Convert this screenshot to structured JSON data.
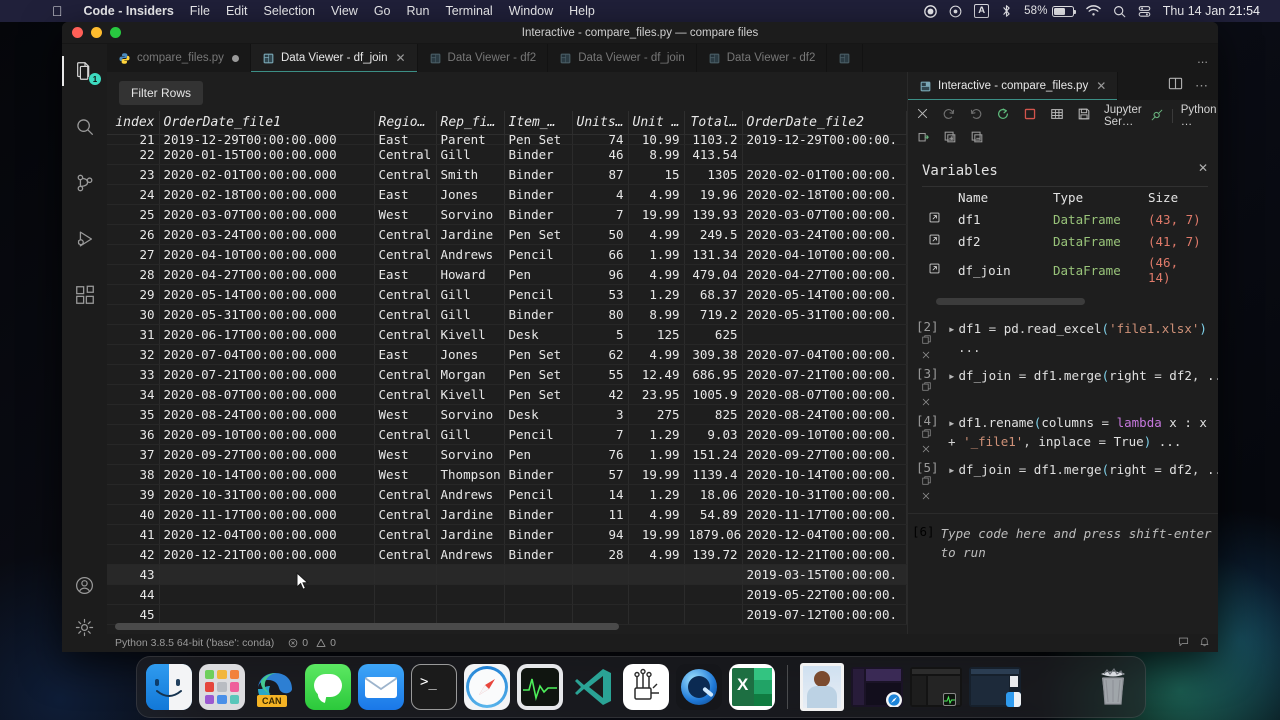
{
  "menubar": {
    "apple_icon": "apple-logo-icon",
    "app_name": "Code - Insiders",
    "items": [
      "File",
      "Edit",
      "Selection",
      "View",
      "Go",
      "Run",
      "Terminal",
      "Window",
      "Help"
    ],
    "status": {
      "record_icon": "record-icon",
      "screen_record_icon": "screen-record-icon",
      "input_source": "A",
      "bluetooth_icon": "bluetooth-icon",
      "battery_percent": "58%",
      "wifi_icon": "wifi-icon",
      "search_icon": "spotlight-search-icon",
      "control_center_icon": "control-center-icon",
      "clock": "Thu 14 Jan  21:54"
    }
  },
  "window": {
    "title": "Interactive - compare_files.py — compare files"
  },
  "activitybar": {
    "items": [
      {
        "name": "explorer",
        "icon": "files-icon",
        "badge": "1",
        "active": true
      },
      {
        "name": "search",
        "icon": "search-icon",
        "badge": "",
        "active": false
      },
      {
        "name": "source-control",
        "icon": "source-control-icon",
        "badge": "",
        "active": false
      },
      {
        "name": "run-and-debug",
        "icon": "run-debug-icon",
        "badge": "",
        "active": false
      },
      {
        "name": "extensions",
        "icon": "extensions-icon",
        "badge": "",
        "active": false
      }
    ],
    "bottom": [
      {
        "name": "accounts",
        "icon": "account-icon"
      },
      {
        "name": "manage",
        "icon": "gear-icon"
      }
    ]
  },
  "tabs": {
    "left_group": [
      {
        "label": "compare_files.py",
        "icon": "python-file-icon",
        "active": false,
        "dirty": true
      },
      {
        "label": "Data Viewer - df_join",
        "icon": "data-viewer-icon",
        "active": true,
        "dirty": false
      },
      {
        "label": "Data Viewer - df2",
        "icon": "data-viewer-icon",
        "active": false,
        "dirty": false
      },
      {
        "label": "Data Viewer - df_join",
        "icon": "data-viewer-icon",
        "active": false,
        "dirty": false
      },
      {
        "label": "Data Viewer - df2",
        "icon": "data-viewer-icon",
        "active": false,
        "dirty": false
      }
    ],
    "left_overflow": "...",
    "right_group": [
      {
        "label": "Interactive - compare_files.py",
        "icon": "notebook-icon",
        "active": true,
        "dirty": false
      }
    ],
    "right_actions": [
      "split-editor-icon",
      "more-actions-icon"
    ]
  },
  "dataviewer": {
    "filter_button": "Filter Rows",
    "columns": [
      "index",
      "OrderDate_file1",
      "Regio…",
      "Rep_fi…",
      "Item_…",
      "Units…",
      "Unit …",
      "Total…",
      "OrderDate_file2"
    ],
    "clipped_top_row": [
      "21",
      "2019-12-29T00:00:00.000",
      "East",
      "Parent",
      "Pen Set",
      "74",
      "10.99",
      "1103.2",
      "2019-12-29T00:00:00."
    ],
    "rows": [
      [
        "22",
        "2020-01-15T00:00:00.000",
        "Central",
        "Gill",
        "Binder",
        "46",
        "8.99",
        "413.54",
        ""
      ],
      [
        "23",
        "2020-02-01T00:00:00.000",
        "Central",
        "Smith",
        "Binder",
        "87",
        "15",
        "1305",
        "2020-02-01T00:00:00."
      ],
      [
        "24",
        "2020-02-18T00:00:00.000",
        "East",
        "Jones",
        "Binder",
        "4",
        "4.99",
        "19.96",
        "2020-02-18T00:00:00."
      ],
      [
        "25",
        "2020-03-07T00:00:00.000",
        "West",
        "Sorvino",
        "Binder",
        "7",
        "19.99",
        "139.93",
        "2020-03-07T00:00:00."
      ],
      [
        "26",
        "2020-03-24T00:00:00.000",
        "Central",
        "Jardine",
        "Pen Set",
        "50",
        "4.99",
        "249.5",
        "2020-03-24T00:00:00."
      ],
      [
        "27",
        "2020-04-10T00:00:00.000",
        "Central",
        "Andrews",
        "Pencil",
        "66",
        "1.99",
        "131.34",
        "2020-04-10T00:00:00."
      ],
      [
        "28",
        "2020-04-27T00:00:00.000",
        "East",
        "Howard",
        "Pen",
        "96",
        "4.99",
        "479.04",
        "2020-04-27T00:00:00."
      ],
      [
        "29",
        "2020-05-14T00:00:00.000",
        "Central",
        "Gill",
        "Pencil",
        "53",
        "1.29",
        "68.37",
        "2020-05-14T00:00:00."
      ],
      [
        "30",
        "2020-05-31T00:00:00.000",
        "Central",
        "Gill",
        "Binder",
        "80",
        "8.99",
        "719.2",
        "2020-05-31T00:00:00."
      ],
      [
        "31",
        "2020-06-17T00:00:00.000",
        "Central",
        "Kivell",
        "Desk",
        "5",
        "125",
        "625",
        ""
      ],
      [
        "32",
        "2020-07-04T00:00:00.000",
        "East",
        "Jones",
        "Pen Set",
        "62",
        "4.99",
        "309.38",
        "2020-07-04T00:00:00."
      ],
      [
        "33",
        "2020-07-21T00:00:00.000",
        "Central",
        "Morgan",
        "Pen Set",
        "55",
        "12.49",
        "686.95",
        "2020-07-21T00:00:00."
      ],
      [
        "34",
        "2020-08-07T00:00:00.000",
        "Central",
        "Kivell",
        "Pen Set",
        "42",
        "23.95",
        "1005.9",
        "2020-08-07T00:00:00."
      ],
      [
        "35",
        "2020-08-24T00:00:00.000",
        "West",
        "Sorvino",
        "Desk",
        "3",
        "275",
        "825",
        "2020-08-24T00:00:00."
      ],
      [
        "36",
        "2020-09-10T00:00:00.000",
        "Central",
        "Gill",
        "Pencil",
        "7",
        "1.29",
        "9.03",
        "2020-09-10T00:00:00."
      ],
      [
        "37",
        "2020-09-27T00:00:00.000",
        "West",
        "Sorvino",
        "Pen",
        "76",
        "1.99",
        "151.24",
        "2020-09-27T00:00:00."
      ],
      [
        "38",
        "2020-10-14T00:00:00.000",
        "West",
        "Thompson",
        "Binder",
        "57",
        "19.99",
        "1139.4",
        "2020-10-14T00:00:00."
      ],
      [
        "39",
        "2020-10-31T00:00:00.000",
        "Central",
        "Andrews",
        "Pencil",
        "14",
        "1.29",
        "18.06",
        "2020-10-31T00:00:00."
      ],
      [
        "40",
        "2020-11-17T00:00:00.000",
        "Central",
        "Jardine",
        "Binder",
        "11",
        "4.99",
        "54.89",
        "2020-11-17T00:00:00."
      ],
      [
        "41",
        "2020-12-04T00:00:00.000",
        "Central",
        "Jardine",
        "Binder",
        "94",
        "19.99",
        "1879.06",
        "2020-12-04T00:00:00."
      ],
      [
        "42",
        "2020-12-21T00:00:00.000",
        "Central",
        "Andrews",
        "Binder",
        "28",
        "4.99",
        "139.72",
        "2020-12-21T00:00:00."
      ],
      [
        "43",
        "",
        "",
        "",
        "",
        "",
        "",
        "",
        "2019-03-15T00:00:00."
      ],
      [
        "44",
        "",
        "",
        "",
        "",
        "",
        "",
        "",
        "2019-05-22T00:00:00."
      ],
      [
        "45",
        "",
        "",
        "",
        "",
        "",
        "",
        "",
        "2019-07-12T00:00:00."
      ]
    ],
    "highlight_row_index": 21
  },
  "interactive": {
    "toolbar_row1": [
      "close-icon",
      "redo-icon",
      "undo-icon",
      "restart-icon",
      "interrupt-icon",
      "variables-icon",
      "save-icon"
    ],
    "toolbar_row2": [
      "export-icon",
      "expand-all-icon",
      "collapse-all-icon"
    ],
    "kernel_server": "Jupyter Ser…",
    "kernel_connected_icon": "plug-connected-icon",
    "kernel_name": "Python …",
    "variables": {
      "title": "Variables",
      "close_icon": "close-icon",
      "headers": [
        "",
        "Name",
        "Type",
        "Size"
      ],
      "rows": [
        {
          "expand_icon": "open-in-viewer-icon",
          "name": "df1",
          "type": "DataFrame",
          "size": "(43, 7)"
        },
        {
          "expand_icon": "open-in-viewer-icon",
          "name": "df2",
          "type": "DataFrame",
          "size": "(41, 7)"
        },
        {
          "expand_icon": "open-in-viewer-icon",
          "name": "df_join",
          "type": "DataFrame",
          "size": "(46, 14)"
        }
      ]
    },
    "cells": [
      {
        "label": "[2]",
        "lines": [
          [
            {
              "t": "df1 ",
              "c": "plain"
            },
            {
              "t": "=",
              "c": "op"
            },
            {
              "t": " pd",
              "c": "plain"
            },
            {
              "t": ".",
              "c": "op"
            },
            {
              "t": "read_excel",
              "c": "plain"
            },
            {
              "t": "(",
              "c": "blue"
            },
            {
              "t": "'file1.xlsx'",
              "c": "str"
            },
            {
              "t": ")",
              "c": "blue"
            }
          ]
        ],
        "output": "...",
        "actions": [
          "copy-icon",
          "clear-icon"
        ]
      },
      {
        "label": "[3]",
        "lines": [
          [
            {
              "t": "df_join ",
              "c": "plain"
            },
            {
              "t": "=",
              "c": "op"
            },
            {
              "t": " df1",
              "c": "plain"
            },
            {
              "t": ".",
              "c": "op"
            },
            {
              "t": "merge",
              "c": "plain"
            },
            {
              "t": "(",
              "c": "blue"
            },
            {
              "t": "right ",
              "c": "plain"
            },
            {
              "t": "=",
              "c": "op"
            },
            {
              "t": " df2",
              "c": "plain"
            },
            {
              "t": ",",
              "c": "op"
            },
            {
              "t": " ...",
              "c": "plain"
            }
          ]
        ],
        "output": "",
        "actions": [
          "copy-icon",
          "clear-icon"
        ]
      },
      {
        "label": "[4]",
        "lines": [
          [
            {
              "t": "df1",
              "c": "plain"
            },
            {
              "t": ".",
              "c": "op"
            },
            {
              "t": "rename",
              "c": "plain"
            },
            {
              "t": "(",
              "c": "blue"
            },
            {
              "t": "columns ",
              "c": "plain"
            },
            {
              "t": "=",
              "c": "op"
            },
            {
              "t": " lambda",
              "c": "kw"
            },
            {
              "t": " x : x",
              "c": "plain"
            }
          ],
          [
            {
              "t": "+ ",
              "c": "op"
            },
            {
              "t": "'_file1'",
              "c": "str"
            },
            {
              "t": ",",
              "c": "op"
            },
            {
              "t": " inplace ",
              "c": "plain"
            },
            {
              "t": "=",
              "c": "op"
            },
            {
              "t": " True",
              "c": "plain"
            },
            {
              "t": ")",
              "c": "blue"
            },
            {
              "t": " ...",
              "c": "plain"
            }
          ]
        ],
        "output": "",
        "actions": [
          "copy-icon",
          "clear-icon"
        ]
      },
      {
        "label": "[5]",
        "lines": [
          [
            {
              "t": "df_join ",
              "c": "plain"
            },
            {
              "t": "=",
              "c": "op"
            },
            {
              "t": " df1",
              "c": "plain"
            },
            {
              "t": ".",
              "c": "op"
            },
            {
              "t": "merge",
              "c": "plain"
            },
            {
              "t": "(",
              "c": "blue"
            },
            {
              "t": "right ",
              "c": "plain"
            },
            {
              "t": "=",
              "c": "op"
            },
            {
              "t": " df2",
              "c": "plain"
            },
            {
              "t": ",",
              "c": "op"
            },
            {
              "t": " ...",
              "c": "plain"
            }
          ]
        ],
        "output": "",
        "actions": [
          "copy-icon",
          "clear-icon"
        ]
      }
    ],
    "prompt": {
      "label": "[6]",
      "placeholder": "Type code here and press shift-enter to run"
    }
  },
  "statusbar": {
    "interpreter": "Python 3.8.5 64-bit ('base': conda)",
    "errors_icon": "error-icon",
    "errors": "0",
    "warnings_icon": "warning-icon",
    "warnings": "0",
    "right_icons": [
      "feedback-icon",
      "bell-icon"
    ]
  },
  "dock": {
    "apps": [
      {
        "name": "finder",
        "label": "Finder",
        "running": true
      },
      {
        "name": "launchpad",
        "label": "Launchpad",
        "running": false
      },
      {
        "name": "edge",
        "label": "Microsoft Edge Canary",
        "badge": "CAN",
        "running": true
      },
      {
        "name": "messages",
        "label": "Messages",
        "running": true
      },
      {
        "name": "mail",
        "label": "Mail",
        "running": true
      },
      {
        "name": "terminal",
        "label": "Terminal",
        "running": true
      },
      {
        "name": "safari",
        "label": "Safari",
        "running": true
      },
      {
        "name": "activity-monitor",
        "label": "Activity Monitor",
        "running": true
      },
      {
        "name": "vscode-insiders",
        "label": "Visual Studio Code - Insiders",
        "running": true
      },
      {
        "name": "arduino",
        "label": "Arduino",
        "running": false
      },
      {
        "name": "quicktime",
        "label": "QuickTime Player",
        "running": false
      },
      {
        "name": "excel",
        "label": "Microsoft Excel",
        "running": true
      }
    ],
    "minimized": [
      {
        "name": "photo-preview",
        "label": "Preview"
      },
      {
        "name": "window-thumb-1",
        "label": "Safari window",
        "overlay": "safari"
      },
      {
        "name": "window-thumb-2",
        "label": "Activity Monitor window",
        "overlay": "activity-monitor"
      },
      {
        "name": "window-thumb-3",
        "label": "Finder window",
        "overlay": "finder"
      }
    ],
    "trash": {
      "name": "trash",
      "label": "Trash"
    }
  }
}
